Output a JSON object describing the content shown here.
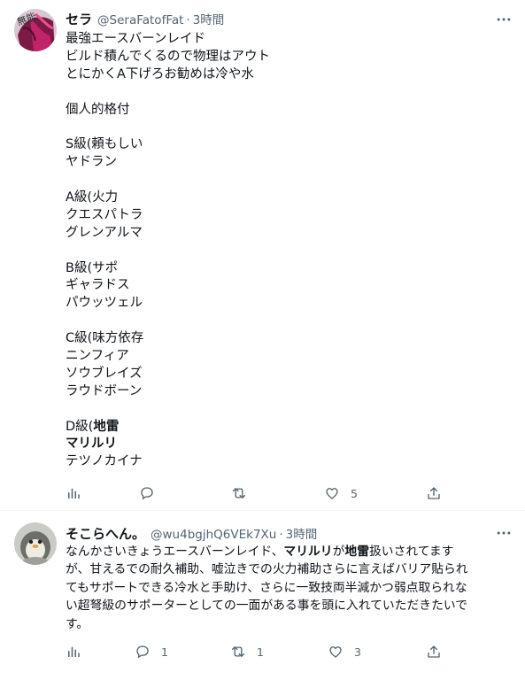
{
  "tweet1": {
    "name": "セラ",
    "handle": "@SeraFatofFat",
    "separator": "·",
    "time": "3時間",
    "avatar_text": "無能",
    "lines": [
      "最強エースバーンレイド",
      "ビルド積んでくるので物理はアウト",
      "とにかくA下げろお勧めは冷や水",
      "",
      "個人的格付",
      "",
      "S級(頼もしい",
      "ヤドラン",
      "",
      "A級(火力",
      "クエスパトラ",
      "グレンアルマ",
      "",
      "B級(サポ",
      "ギャラドス",
      "パウッツェル",
      "",
      "C級(味方依存",
      "ニンフィア",
      "ソウブレイズ",
      "ラウドボーン",
      "",
      "D級(",
      "地雷",
      "マリルリ",
      "テツノカイナ"
    ],
    "actions": {
      "reply_count": "",
      "retweet_count": "",
      "like_count": "5"
    }
  },
  "tweet2": {
    "name": "そこらへん。",
    "handle": "@wu4bgjhQ6VEk7Xu",
    "separator": "·",
    "time": "3時間",
    "line1_a": "なんかさいきょうエースバーンレイド、",
    "line1_b": "マリルリ",
    "line1_c": "が",
    "line1_d": "地雷",
    "line1_e": "扱いされてます",
    "line2": "が、甘えるでの耐久補助、嘘泣きでの火力補助さらに言えばバリア貼られ",
    "line3": "てもサポートできる冷水と手助け、さらに一致技両半減かつ弱点取られな",
    "line4": "い超弩級のサポーターとしての一面がある事を頭に入れていただきたいで",
    "line5": "す。",
    "actions": {
      "reply_count": "1",
      "retweet_count": "1",
      "like_count": "3"
    }
  },
  "colors": {
    "text": "#0f1419",
    "secondary": "#536471",
    "divider": "#eff3f4"
  },
  "icons": [
    "more-icon",
    "analytics-icon",
    "reply-icon",
    "retweet-icon",
    "like-icon",
    "share-icon"
  ]
}
